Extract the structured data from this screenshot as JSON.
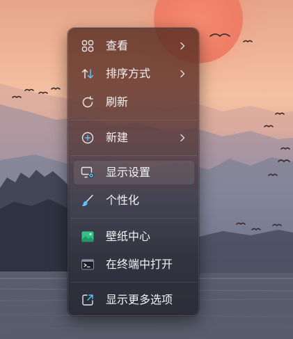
{
  "desktop": {
    "wallpaper": "sunset-lake-mountains"
  },
  "context_menu": {
    "items": [
      {
        "label": "查看",
        "icon": "grid-icon",
        "has_submenu": true
      },
      {
        "label": "排序方式",
        "icon": "sort-arrows-icon",
        "has_submenu": true
      },
      {
        "label": "刷新",
        "icon": "refresh-icon",
        "has_submenu": false
      },
      {
        "label": "新建",
        "icon": "add-circle-icon",
        "has_submenu": true
      },
      {
        "label": "显示设置",
        "icon": "display-settings-icon",
        "has_submenu": false
      },
      {
        "label": "个性化",
        "icon": "brush-icon",
        "has_submenu": false
      },
      {
        "label": "壁纸中心",
        "icon": "wallpaper-icon",
        "has_submenu": false
      },
      {
        "label": "在终端中打开",
        "icon": "terminal-icon",
        "has_submenu": false
      },
      {
        "label": "显示更多选项",
        "icon": "open-external-icon",
        "has_submenu": false
      }
    ],
    "hovered_item": "显示设置"
  },
  "colors": {
    "icon_blue": "#60c3ff",
    "wallpaper_green": "#35c08a",
    "label_text": "#f3f3f3"
  }
}
